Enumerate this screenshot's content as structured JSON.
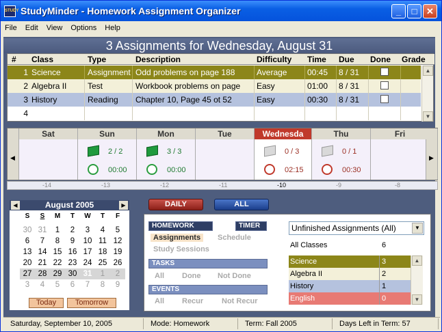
{
  "window": {
    "title": "StudyMinder - Homework Assignment Organizer",
    "app_icon": "STUDY"
  },
  "menu": [
    "File",
    "Edit",
    "View",
    "Options",
    "Help"
  ],
  "header_title": "3 Assignments for Wednesday, August 31",
  "columns": [
    "#",
    "Class",
    "Type",
    "Description",
    "Difficulty",
    "Time",
    "Due",
    "Done",
    "Grade"
  ],
  "rows": [
    {
      "num": "1",
      "class": "Science",
      "type": "Assignment",
      "desc": "Odd problems on page 188",
      "diff": "Average",
      "time": "00:45",
      "due": "8 / 31",
      "color": "#8c8619"
    },
    {
      "num": "2",
      "class": "Algebra II",
      "type": "Test",
      "desc": "Workbook problems on page",
      "diff": "Easy",
      "time": "01:00",
      "due": "8 / 31",
      "color": "#f3f0d9"
    },
    {
      "num": "3",
      "class": "History",
      "type": "Reading",
      "desc": "Chapter 10, Page 45 ot 52",
      "diff": "Easy",
      "time": "00:30",
      "due": "8 / 31",
      "color": "#b5c2de"
    },
    {
      "num": "4",
      "class": "",
      "type": "",
      "desc": "",
      "diff": "",
      "time": "",
      "due": "",
      "color": "#ffffff"
    }
  ],
  "week": {
    "days": [
      "Sat",
      "Sun",
      "Mon",
      "Tue",
      "Wednesda",
      "Thu",
      "Fri"
    ],
    "sun": {
      "count": "2 / 2",
      "time": "00:00"
    },
    "mon": {
      "count": "3 / 3",
      "time": "00:00"
    },
    "wed": {
      "count": "0 / 3",
      "time": "02:15"
    },
    "thu": {
      "count": "0 / 1",
      "time": "00:30"
    },
    "offsets": [
      "-14",
      "-13",
      "-12",
      "-11",
      "-10",
      "-9",
      "-8"
    ]
  },
  "calendar": {
    "month": "August 2005",
    "dow": [
      "S",
      "S",
      "M",
      "T",
      "W",
      "T",
      "F"
    ],
    "weeks": [
      [
        "30",
        "31",
        "1",
        "2",
        "3",
        "4",
        "5"
      ],
      [
        "6",
        "7",
        "8",
        "9",
        "10",
        "11",
        "12"
      ],
      [
        "13",
        "14",
        "15",
        "16",
        "17",
        "18",
        "19"
      ],
      [
        "20",
        "21",
        "22",
        "23",
        "24",
        "25",
        "26"
      ],
      [
        "27",
        "28",
        "29",
        "30",
        "31",
        "1",
        "2"
      ],
      [
        "3",
        "4",
        "5",
        "6",
        "7",
        "8",
        "9"
      ]
    ],
    "today_btn": "Today",
    "tomorrow_btn": "Tomorrow"
  },
  "buttons": {
    "daily": "DAILY",
    "all": "ALL"
  },
  "filter": {
    "homework": "HOMEWORK",
    "timer": "TIMER",
    "assignments": "Assignments",
    "schedule": "Schedule",
    "study_sessions": "Study Sessions",
    "tasks": "TASKS",
    "tasks_all": "All",
    "tasks_done": "Done",
    "tasks_notdone": "Not Done",
    "events": "EVENTS",
    "events_all": "All",
    "events_recur": "Recur",
    "events_notrecur": "Not Recur",
    "dropdown": "Unfinished Assignments (All)",
    "all_classes": "All Classes",
    "all_classes_count": "6",
    "class_counts": [
      {
        "name": "Science",
        "count": "3",
        "color": "#8c8619",
        "text": "#ffffff"
      },
      {
        "name": "Algebra II",
        "count": "2",
        "color": "#f3f0d9",
        "text": "#000000"
      },
      {
        "name": "History",
        "count": "1",
        "color": "#b5c2de",
        "text": "#000000"
      },
      {
        "name": "English",
        "count": "0",
        "color": "#e87a74",
        "text": "#ffffff"
      }
    ]
  },
  "status": {
    "date": "Saturday, September 10, 2005",
    "mode": "Mode: Homework",
    "term": "Term: Fall 2005",
    "days_left": "Days Left in Term: 57"
  }
}
